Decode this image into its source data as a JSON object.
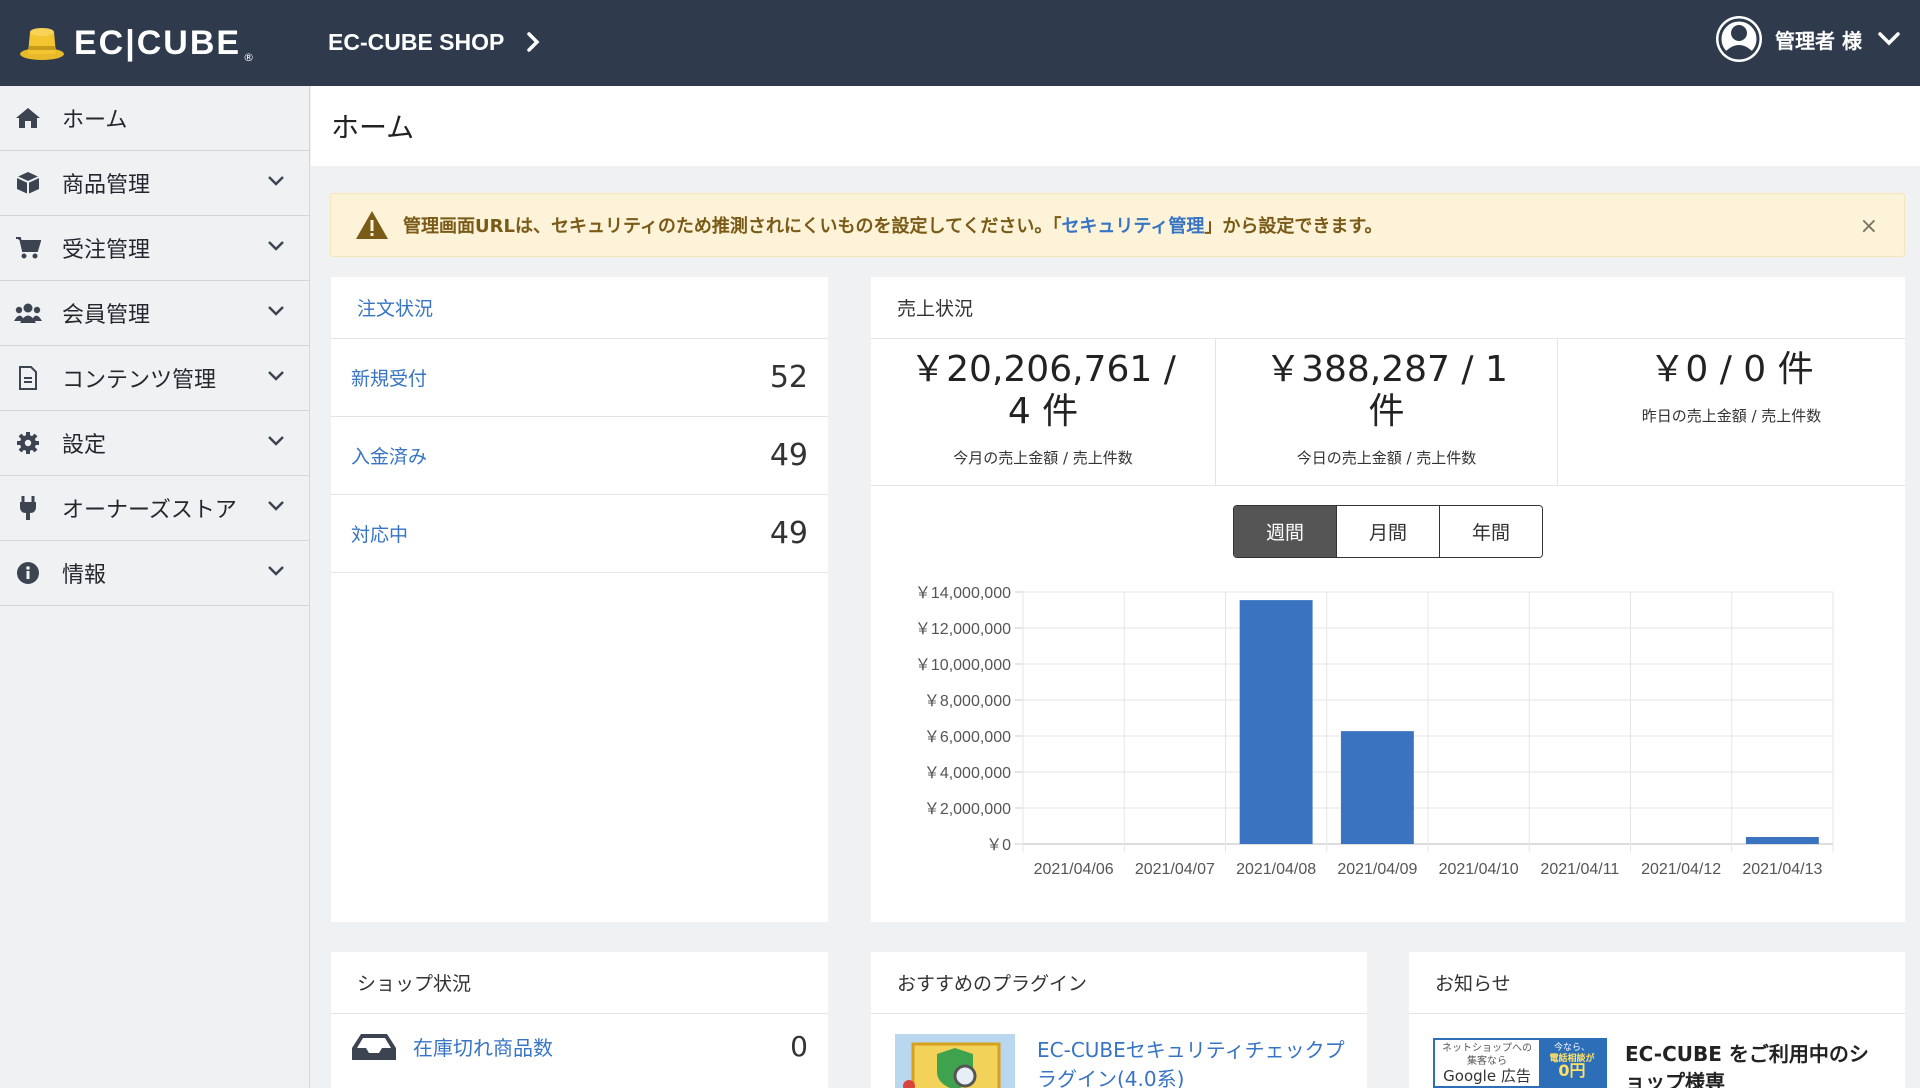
{
  "header": {
    "logo_text": "EC|CUBE",
    "logo_reg": "®",
    "shop_name": "EC-CUBE SHOP",
    "user_name": "管理者 様"
  },
  "sidebar": {
    "items": [
      {
        "label": "ホーム",
        "icon": "home-icon"
      },
      {
        "label": "商品管理",
        "icon": "box-icon"
      },
      {
        "label": "受注管理",
        "icon": "cart-icon"
      },
      {
        "label": "会員管理",
        "icon": "users-icon"
      },
      {
        "label": "コンテンツ管理",
        "icon": "file-icon"
      },
      {
        "label": "設定",
        "icon": "gear-icon"
      },
      {
        "label": "オーナーズストア",
        "icon": "plug-icon"
      },
      {
        "label": "情報",
        "icon": "info-icon"
      }
    ]
  },
  "page": {
    "title": "ホーム"
  },
  "alert": {
    "before": "管理画面URLは、セキュリティのため推測されにくいものを設定してください。「",
    "link": "セキュリティ管理",
    "after": "」から設定できます。",
    "close": "×"
  },
  "order_status": {
    "title": "注文状況",
    "rows": [
      {
        "label": "新規受付",
        "value": "52"
      },
      {
        "label": "入金済み",
        "value": "49"
      },
      {
        "label": "対応中",
        "value": "49"
      }
    ]
  },
  "sales": {
    "title": "売上状況",
    "summaries": [
      {
        "value": "￥20,206,761 / 4 件",
        "label": "今月の売上金額 / 売上件数"
      },
      {
        "value": "￥388,287 / 1 件",
        "label": "今日の売上金額 / 売上件数"
      },
      {
        "value": "￥0 / 0 件",
        "label": "昨日の売上金額 / 売上件数"
      }
    ],
    "tabs": [
      "週間",
      "月間",
      "年間"
    ],
    "active_tab": 0
  },
  "chart_data": {
    "type": "bar",
    "categories": [
      "2021/04/06",
      "2021/04/07",
      "2021/04/08",
      "2021/04/09",
      "2021/04/10",
      "2021/04/11",
      "2021/04/12",
      "2021/04/13"
    ],
    "values": [
      0,
      0,
      13550000,
      6270000,
      0,
      0,
      0,
      388287
    ],
    "ylim": [
      0,
      14000000
    ],
    "yticks": [
      0,
      2000000,
      4000000,
      6000000,
      8000000,
      10000000,
      12000000,
      14000000
    ],
    "ytick_labels": [
      "￥0",
      "￥2,000,000",
      "￥4,000,000",
      "￥6,000,000",
      "￥8,000,000",
      "￥10,000,000",
      "￥12,000,000",
      "￥14,000,000"
    ],
    "bar_color": "#3a74c1",
    "grid": true
  },
  "shop_status": {
    "title": "ショップ状況",
    "rows": [
      {
        "label": "在庫切れ商品数",
        "value": "0"
      }
    ]
  },
  "plugins": {
    "title": "おすすめのプラグイン",
    "items": [
      {
        "title": "EC-CUBEセキュリティチェックプラグイン(4.0系)"
      }
    ]
  },
  "news": {
    "title": "お知らせ",
    "thumb": {
      "line1": "ネットショップへの",
      "line2": "集客なら",
      "line3": "Google 広告",
      "r1": "今なら、",
      "r2": "電話相談が",
      "r3": "0円"
    },
    "items": [
      {
        "title": "EC-CUBE をご利用中のショップ様専"
      }
    ]
  },
  "colors": {
    "header_bg": "#2f3b4c",
    "link": "#3774c4",
    "alert_bg": "#fdf3d8",
    "alert_text": "#7a5a17"
  }
}
